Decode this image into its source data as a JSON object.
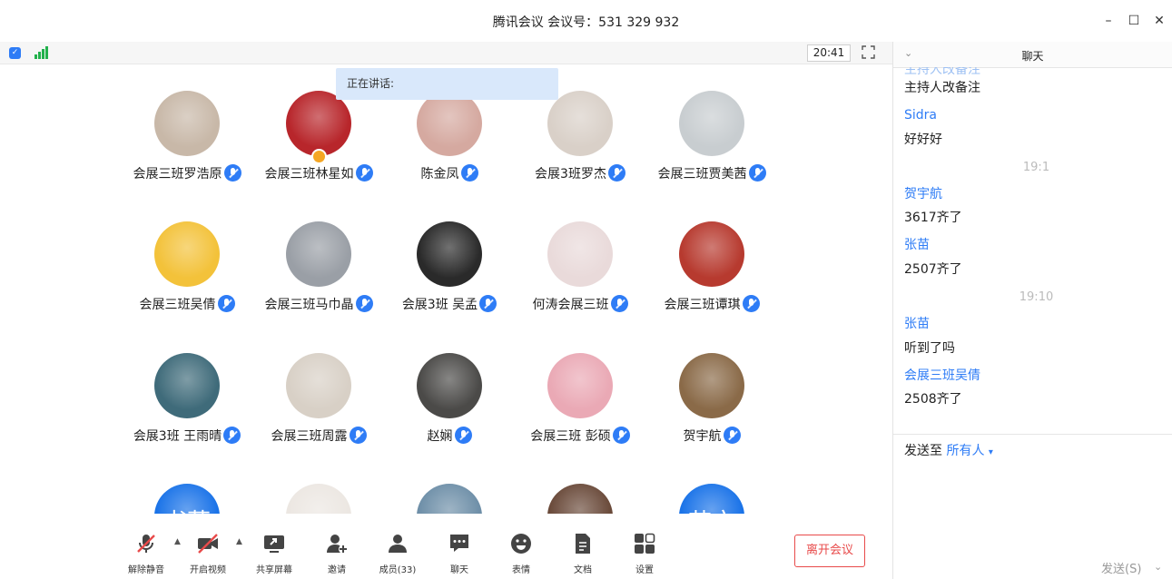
{
  "window": {
    "title": "腾讯会议 会议号：531 329 932",
    "minimize_icon": "–",
    "maximize_icon": "☐",
    "close_icon": "✕"
  },
  "status": {
    "clock": "20:41"
  },
  "speaking": {
    "label": "正在讲话:"
  },
  "participants": [
    {
      "name": "会展三班罗浩原",
      "color": "#c8b8a8"
    },
    {
      "name": "会展三班林星如",
      "color": "#b8262b"
    },
    {
      "name": "陈金凤",
      "color": "#d5a9a0"
    },
    {
      "name": "会展3班罗杰",
      "color": "#d9d0c8"
    },
    {
      "name": "会展三班贾美茜",
      "color": "#c8cdd0"
    },
    {
      "name": "会展三班吴倩",
      "color": "#f3c23a"
    },
    {
      "name": "会展三班马巾晶",
      "color": "#9a9fa6"
    },
    {
      "name": "会展3班 吴孟",
      "color": "#2a2a2a"
    },
    {
      "name": "何涛会展三班",
      "color": "#e9dada"
    },
    {
      "name": "会展三班谭琪",
      "color": "#b73a2f"
    },
    {
      "name": "会展3班 王雨晴",
      "color": "#3f6b7a"
    },
    {
      "name": "会展三班周露",
      "color": "#d8d0c6"
    },
    {
      "name": "赵娴",
      "color": "#4b4a48"
    },
    {
      "name": "会展三班  彭硕",
      "color": "#eaa9b5"
    },
    {
      "name": "贺宇航",
      "color": "#8a6a48"
    },
    {
      "name": "",
      "color": "#1a73e8",
      "initials": "书菲"
    },
    {
      "name": "",
      "color": "#ece7e2"
    },
    {
      "name": "",
      "color": "#6e8fa8"
    },
    {
      "name": "",
      "color": "#6a4a3a"
    },
    {
      "name": "",
      "color": "#1a73e8",
      "initials": "苗文"
    }
  ],
  "toolbar": {
    "unmute": "解除静音",
    "start_video": "开启视频",
    "share_screen": "共享屏幕",
    "invite": "邀请",
    "members": "成员(33)",
    "chat": "聊天",
    "emoji": "表情",
    "docs": "文档",
    "settings": "设置",
    "leave": "离开会议",
    "caret": "▲"
  },
  "chat": {
    "header": "聊天",
    "collapse_icon": "⌄",
    "messages": [
      {
        "text": "主持人改备注"
      },
      {
        "sender": "Sidra",
        "text": "好好好"
      },
      {
        "time": "19:1"
      },
      {
        "sender": "贺宇航",
        "text": "3617齐了"
      },
      {
        "sender": "张苗",
        "text": "2507齐了"
      },
      {
        "time": "19:10"
      },
      {
        "sender": "张苗",
        "text": "听到了吗"
      },
      {
        "sender": "会展三班吴倩",
        "text": "2508齐了"
      }
    ],
    "send_to_label": "发送至",
    "audience": "所有人",
    "audience_caret": "▾",
    "send_button": "发送(S)",
    "send_caret": "⌄"
  },
  "colors": {
    "accent": "#2e7cf6",
    "leave": "#e84a4a",
    "speaking_bg": "#d9e8fb",
    "signal": "#22b14c"
  }
}
